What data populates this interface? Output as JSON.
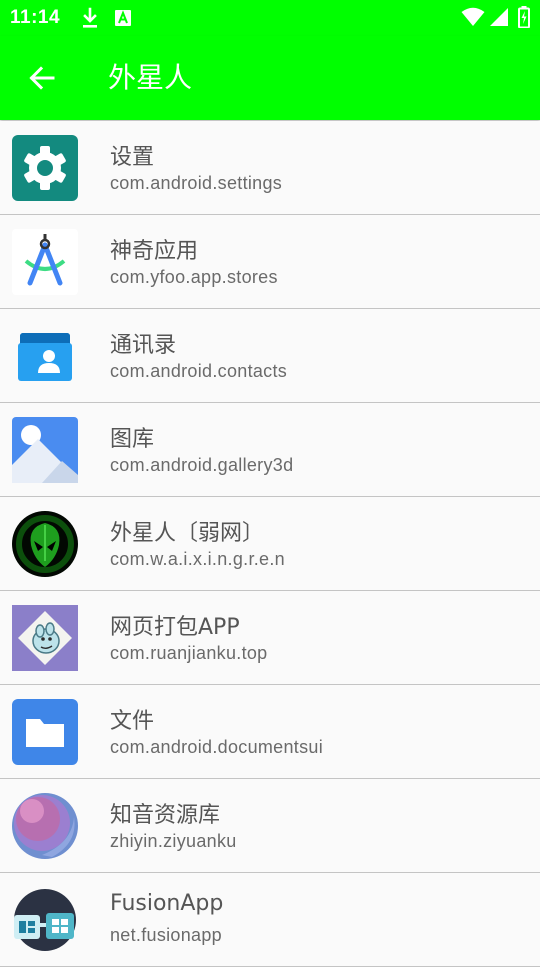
{
  "status_bar": {
    "time": "11:14",
    "icons": [
      "download-icon",
      "text-a-icon",
      "wifi-icon",
      "signal-icon",
      "battery-charging-icon"
    ]
  },
  "toolbar": {
    "title": "外星人",
    "back_icon": "arrow-back-icon",
    "color": "#00ff00"
  },
  "apps": [
    {
      "name": "设置",
      "package": "com.android.settings",
      "icon": "settings-gear-icon"
    },
    {
      "name": "神奇应用",
      "package": "com.yfoo.app.stores",
      "icon": "android-studio-icon"
    },
    {
      "name": "通讯录",
      "package": "com.android.contacts",
      "icon": "contacts-icon"
    },
    {
      "name": "图库",
      "package": "com.android.gallery3d",
      "icon": "gallery-icon"
    },
    {
      "name": "外星人〔弱网〕",
      "package": "com.w.a.i.x.i.n.g.r.e.n",
      "icon": "alien-icon"
    },
    {
      "name": "网页打包APP",
      "package": "com.ruanjianku.top",
      "icon": "moomin-icon"
    },
    {
      "name": "文件",
      "package": "com.android.documentsui",
      "icon": "folder-icon"
    },
    {
      "name": "知音资源库",
      "package": "zhiyin.ziyuanku",
      "icon": "planet-icon"
    },
    {
      "name": "FusionApp",
      "package": "net.fusionapp",
      "icon": "fusionapp-icon"
    }
  ]
}
